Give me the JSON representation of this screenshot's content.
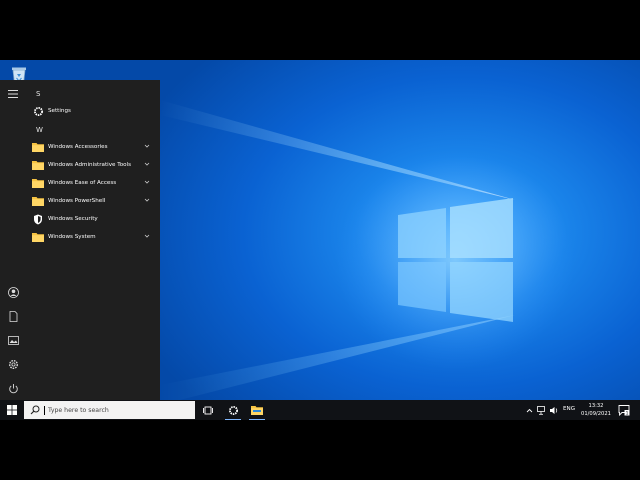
{
  "desktop": {
    "recycle_bin_icon": "recycle-bin-icon",
    "colors": {
      "accent": "#0a62d2",
      "menu_bg": "#1f1f1f",
      "taskbar_bg": "#101216",
      "folder": "#f6c342"
    }
  },
  "start_menu": {
    "sections": [
      {
        "letter": "S"
      },
      {
        "letter": "W"
      }
    ],
    "items": [
      {
        "label": "Settings",
        "icon": "gear-icon"
      },
      {
        "label": "Windows Accessories",
        "icon": "folder-icon"
      },
      {
        "label": "Windows Administrative Tools",
        "icon": "folder-icon"
      },
      {
        "label": "Windows Ease of Access",
        "icon": "folder-icon"
      },
      {
        "label": "Windows PowerShell",
        "icon": "folder-icon"
      },
      {
        "label": "Windows Security",
        "icon": "shield-icon"
      },
      {
        "label": "Windows System",
        "icon": "folder-icon"
      }
    ],
    "rail_icons": [
      "hamburger-icon",
      "user-icon",
      "document-icon",
      "pictures-icon",
      "settings-icon",
      "power-icon"
    ]
  },
  "taskbar": {
    "search_placeholder": "Type here to search",
    "lang": "ENG",
    "time": "13:32",
    "date": "01/09/2021"
  }
}
